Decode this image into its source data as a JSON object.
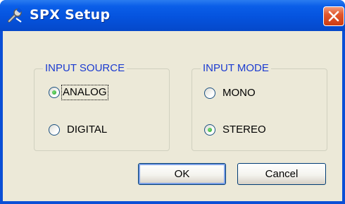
{
  "window": {
    "title": "SPX Setup",
    "title_icon": "settings-tool-icon",
    "close_icon": "close-icon"
  },
  "input_source": {
    "label": "INPUT SOURCE",
    "options": [
      {
        "label": "ANALOG",
        "selected": true
      },
      {
        "label": "DIGITAL",
        "selected": false
      }
    ]
  },
  "input_mode": {
    "label": "INPUT MODE",
    "options": [
      {
        "label": "MONO",
        "selected": false
      },
      {
        "label": "STEREO",
        "selected": true
      }
    ]
  },
  "buttons": {
    "ok": "OK",
    "cancel": "Cancel"
  },
  "colors": {
    "titlebar": "#0553de",
    "group_label": "#1b3bd0",
    "dialog_bg": "#ece9d8",
    "close": "#e2572d"
  }
}
